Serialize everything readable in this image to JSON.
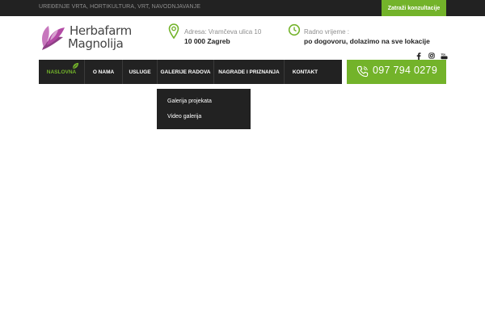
{
  "topbar": {
    "tagline": "UREĐENJE VRTA, HORTIKULTURA, VRT, NAVODNJAVANJE",
    "cta_label": "Zatraži konzultacije"
  },
  "logo": {
    "line1": "Herbafarm",
    "line2": "Magnolija"
  },
  "contact": {
    "address_label": "Adresa: Vramčeva ulica 10",
    "address_value": "10 000 Zagreb",
    "hours_label": "Radno vrijeme :",
    "hours_value": "po dogovoru, dolazimo na sve lokacije"
  },
  "social": {
    "icons": [
      "facebook-icon",
      "instagram-icon",
      "youtube-icon"
    ]
  },
  "nav": {
    "items": [
      {
        "label": "NASLOVNA",
        "active": true
      },
      {
        "label": "O NAMA"
      },
      {
        "label": "USLUGE"
      },
      {
        "label": "GALERIJE RADOVA"
      },
      {
        "label": "NAGRADE I PRIZNANJA"
      },
      {
        "label": "KONTAKT"
      }
    ]
  },
  "phone": {
    "number": "097 794 0279"
  },
  "dropdown": {
    "items": [
      "Galerija projekata",
      "Video galerija"
    ]
  },
  "colors": {
    "accent_green": "#73b32a",
    "dark_bar": "#222222",
    "logo_purple": "#b34aa5"
  }
}
